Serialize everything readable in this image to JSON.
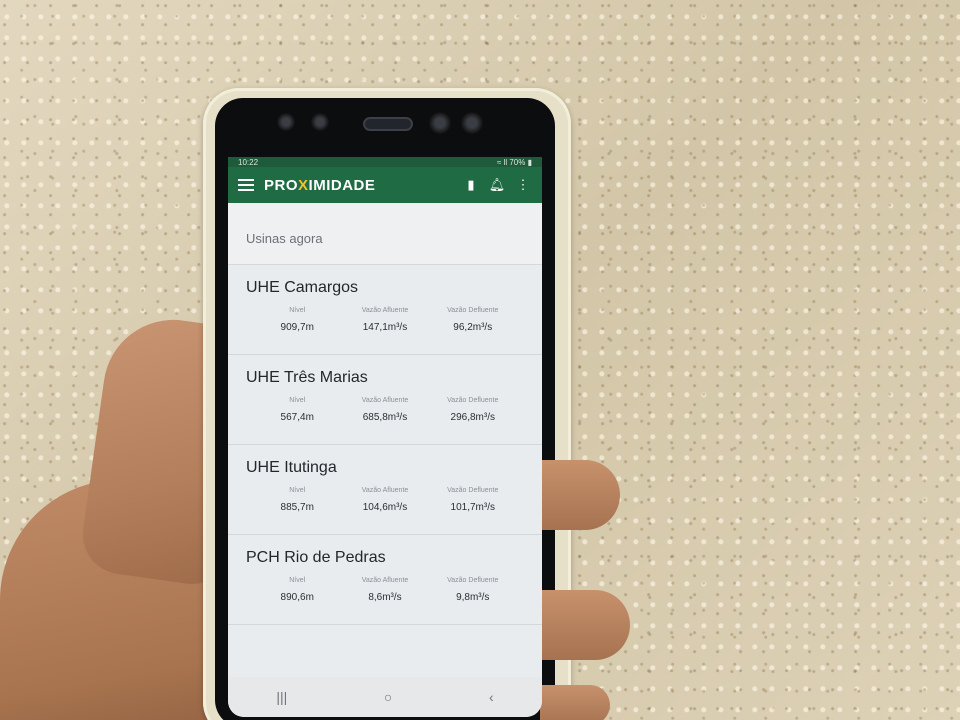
{
  "statusbar": {
    "time": "10:22",
    "right": "≈ ll 70% ▮"
  },
  "appbar": {
    "title_pre": "PRO",
    "title_x": "X",
    "title_post": "IMIDADE",
    "map_icon": "map-icon",
    "bell_icon": "bell-icon",
    "more_icon": "more-vert-icon"
  },
  "section": {
    "title": "Usinas agora"
  },
  "labels": {
    "nivel": "Nível",
    "afluente": "Vazão Afluente",
    "defluente": "Vazão Defluente"
  },
  "plants": [
    {
      "name": "UHE Camargos",
      "nivel": "909,7m",
      "afluente": "147,1m³/s",
      "defluente": "96,2m³/s"
    },
    {
      "name": "UHE Três Marias",
      "nivel": "567,4m",
      "afluente": "685,8m³/s",
      "defluente": "296,8m³/s"
    },
    {
      "name": "UHE Itutinga",
      "nivel": "885,7m",
      "afluente": "104,6m³/s",
      "defluente": "101,7m³/s"
    },
    {
      "name": "PCH Rio de Pedras",
      "nivel": "890,6m",
      "afluente": "8,6m³/s",
      "defluente": "9,8m³/s"
    }
  ],
  "navbar": {
    "recents": "|||",
    "home": "○",
    "back": "‹"
  },
  "colors": {
    "appbar": "#1f6b43",
    "accent": "#f2c230",
    "background": "#e9ecef"
  }
}
